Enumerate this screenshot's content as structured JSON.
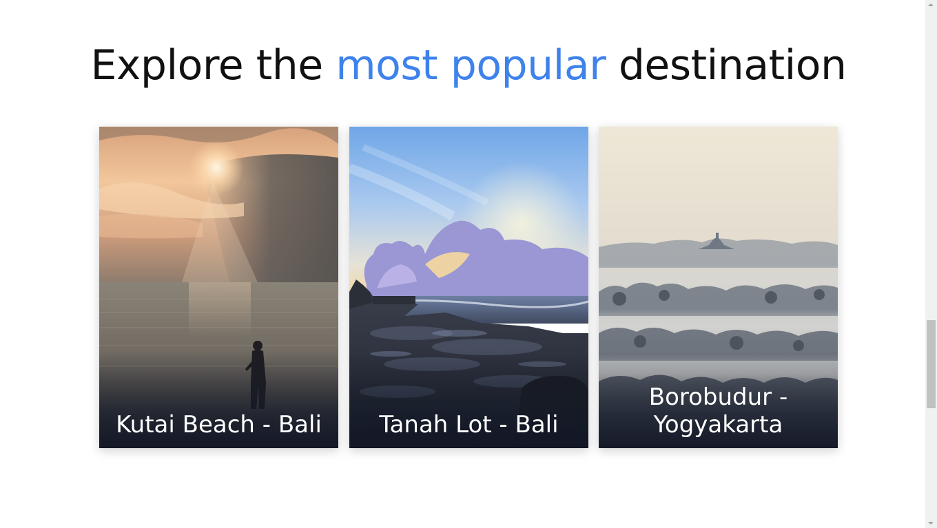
{
  "heading": {
    "prefix": "Explore the ",
    "accent": "most popular",
    "suffix": " destination",
    "accent_color": "#3e82ec"
  },
  "destinations": [
    {
      "label": "Kutai Beach - Bali",
      "image": "sunset-sea-fisherman"
    },
    {
      "label": "Tanah Lot - Bali",
      "image": "rocky-coast-clouds"
    },
    {
      "label": "Borobudur - Yogyakarta",
      "image": "misty-temple-forest"
    }
  ],
  "scrollbar": {
    "position_fraction": 0.61
  }
}
